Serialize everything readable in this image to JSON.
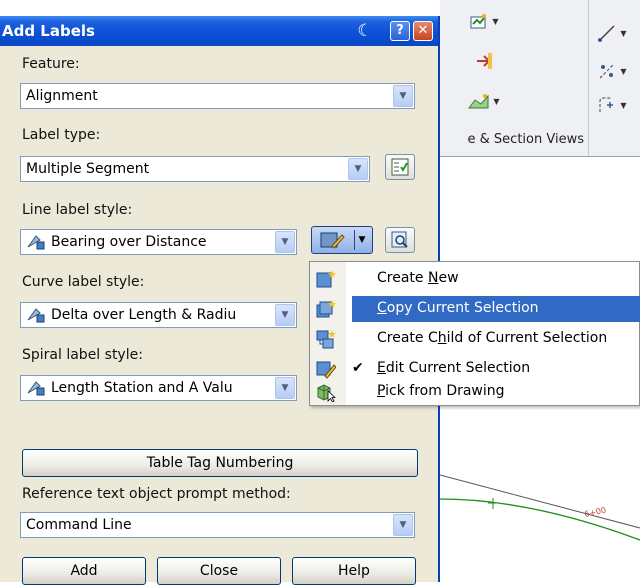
{
  "dialog": {
    "title": "Add Labels",
    "feature_label": "Feature:",
    "feature_value": "Alignment",
    "label_type_label": "Label type:",
    "label_type_value": "Multiple Segment",
    "line_label_style_label": "Line label style:",
    "line_label_style_value": "Bearing over Distance",
    "curve_label_style_label": "Curve label style:",
    "curve_label_style_value": "Delta over Length & Radiu",
    "spiral_label_style_label": "Spiral label style:",
    "spiral_label_style_value": "Length Station and A Valu",
    "table_tag_button": "Table Tag Numbering",
    "reference_prompt_label": "Reference text object prompt method:",
    "reference_prompt_value": "Command Line",
    "add_button": "Add",
    "close_button": "Close",
    "help_button": "Help"
  },
  "context_menu": {
    "items": [
      {
        "pre": "Create ",
        "mnemonic": "N",
        "post": "ew",
        "icon": "create-new-icon",
        "checked": false,
        "highlighted": false
      },
      {
        "pre": "",
        "mnemonic": "C",
        "post": "opy Current Selection",
        "icon": "copy-style-icon",
        "checked": false,
        "highlighted": true
      },
      {
        "pre": "Create C",
        "mnemonic": "h",
        "post": "ild of Current Selection",
        "icon": "create-child-icon",
        "checked": false,
        "highlighted": false
      },
      {
        "pre": "",
        "mnemonic": "E",
        "post": "dit Current Selection",
        "icon": "edit-style-icon",
        "checked": true,
        "highlighted": false
      },
      {
        "pre": "",
        "mnemonic": "P",
        "post": "ick from Drawing",
        "icon": "pick-from-drawing-icon",
        "checked": false,
        "highlighted": false
      }
    ]
  },
  "background": {
    "ribbon_section_label": "e & Section Views",
    "drawing_label": "6+00"
  },
  "colors": {
    "titlebar": "#0a4fd6",
    "dialog_bg": "#ece9d8",
    "menu_highlight": "#316ac5",
    "alignment_line": "#1a8f1a"
  }
}
